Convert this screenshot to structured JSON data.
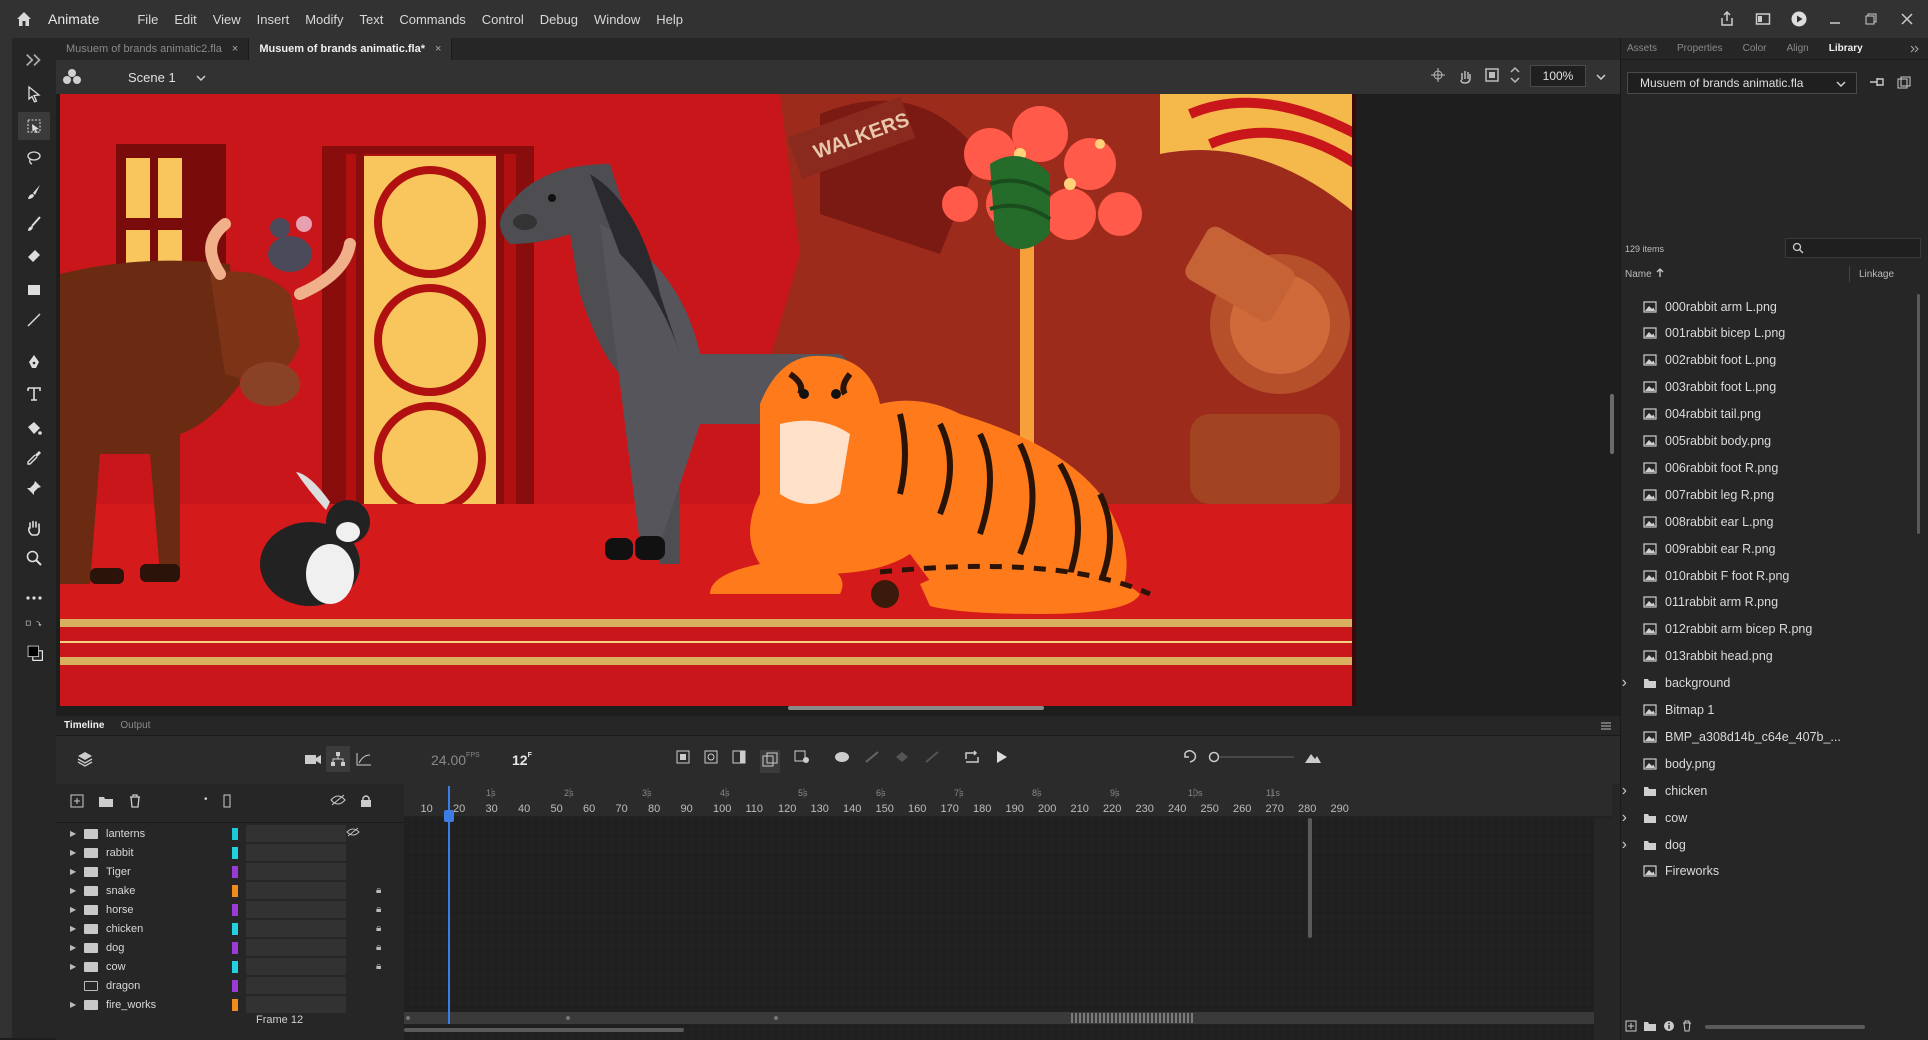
{
  "app": {
    "name": "Animate"
  },
  "menu": [
    "File",
    "Edit",
    "View",
    "Insert",
    "Modify",
    "Text",
    "Commands",
    "Control",
    "Debug",
    "Window",
    "Help"
  ],
  "doc_tabs": [
    {
      "label": "Musuem of brands animatic2.fla",
      "active": false
    },
    {
      "label": "Musuem of brands animatic.fla*",
      "active": true
    }
  ],
  "editbar": {
    "scene": "Scene 1",
    "zoom": "100%"
  },
  "stage_art": {
    "sign_text": "WALKERS"
  },
  "timeline": {
    "tabs": [
      "Timeline",
      "Output"
    ],
    "fps": "24.00",
    "fps_unit": "FPS",
    "frame": "12",
    "frame_unit": "F",
    "frame_label": "Frame  12",
    "ruler_seconds": [
      "1s",
      "2s",
      "3s",
      "4s",
      "5s",
      "6s",
      "7s",
      "8s",
      "9s",
      "10s",
      "11s"
    ],
    "ruler_frames": [
      "10",
      "20",
      "30",
      "40",
      "50",
      "60",
      "70",
      "80",
      "90",
      "100",
      "110",
      "120",
      "130",
      "140",
      "150",
      "160",
      "170",
      "180",
      "190",
      "200",
      "210",
      "220",
      "230",
      "240",
      "250",
      "260",
      "270",
      "280",
      "290"
    ],
    "layers": [
      {
        "name": "lanterns",
        "color": "#1ec8d8",
        "locked": false,
        "hidden": true
      },
      {
        "name": "rabbit",
        "color": "#22d0e0",
        "locked": false,
        "hidden": false
      },
      {
        "name": "Tiger",
        "color": "#9b3bd6",
        "locked": false,
        "hidden": false
      },
      {
        "name": "snake",
        "color": "#f08c1c",
        "locked": true,
        "hidden": false
      },
      {
        "name": "horse",
        "color": "#9b3bd6",
        "locked": true,
        "hidden": false
      },
      {
        "name": "chicken",
        "color": "#22d0e0",
        "locked": true,
        "hidden": false
      },
      {
        "name": "dog",
        "color": "#9b3bd6",
        "locked": true,
        "hidden": false
      },
      {
        "name": "cow",
        "color": "#22d0e0",
        "locked": true,
        "hidden": false
      },
      {
        "name": "dragon",
        "color": "#9b3bd6",
        "locked": false,
        "hidden": false
      },
      {
        "name": "fire_works",
        "color": "#f08c1c",
        "locked": false,
        "hidden": false
      }
    ]
  },
  "right_panel": {
    "tabs": [
      "Assets",
      "Properties",
      "Color",
      "Align",
      "Library"
    ],
    "library_file": "Musuem of brands animatic.fla",
    "item_count": "129 items",
    "col_name": "Name",
    "col_linkage": "Linkage",
    "items": [
      {
        "name": "000rabbit arm L.png",
        "type": "bitmap"
      },
      {
        "name": "001rabbit bicep L.png",
        "type": "bitmap"
      },
      {
        "name": "002rabbit foot L.png",
        "type": "bitmap"
      },
      {
        "name": "003rabbit foot L.png",
        "type": "bitmap"
      },
      {
        "name": "004rabbit tail.png",
        "type": "bitmap"
      },
      {
        "name": "005rabbit body.png",
        "type": "bitmap"
      },
      {
        "name": "006rabbit foot R.png",
        "type": "bitmap"
      },
      {
        "name": "007rabbit leg R.png",
        "type": "bitmap"
      },
      {
        "name": "008rabbit ear L.png",
        "type": "bitmap"
      },
      {
        "name": "009rabbit ear R.png",
        "type": "bitmap"
      },
      {
        "name": "010rabbit F foot R.png",
        "type": "bitmap"
      },
      {
        "name": "011rabbit arm R.png",
        "type": "bitmap"
      },
      {
        "name": "012rabbit arm bicep R.png",
        "type": "bitmap"
      },
      {
        "name": "013rabbit head.png",
        "type": "bitmap"
      },
      {
        "name": "background",
        "type": "folder"
      },
      {
        "name": "Bitmap 1",
        "type": "bitmap"
      },
      {
        "name": "BMP_a308d14b_c64e_407b_...",
        "type": "bitmap"
      },
      {
        "name": "body.png",
        "type": "bitmap"
      },
      {
        "name": "chicken",
        "type": "folder"
      },
      {
        "name": "cow",
        "type": "folder"
      },
      {
        "name": "dog",
        "type": "folder"
      },
      {
        "name": "Fireworks",
        "type": "bitmap"
      }
    ]
  },
  "colors": {
    "stage_red": "#cf1616",
    "accent_blue": "#3d7de3",
    "tiger_orange": "#ff7a1a"
  }
}
